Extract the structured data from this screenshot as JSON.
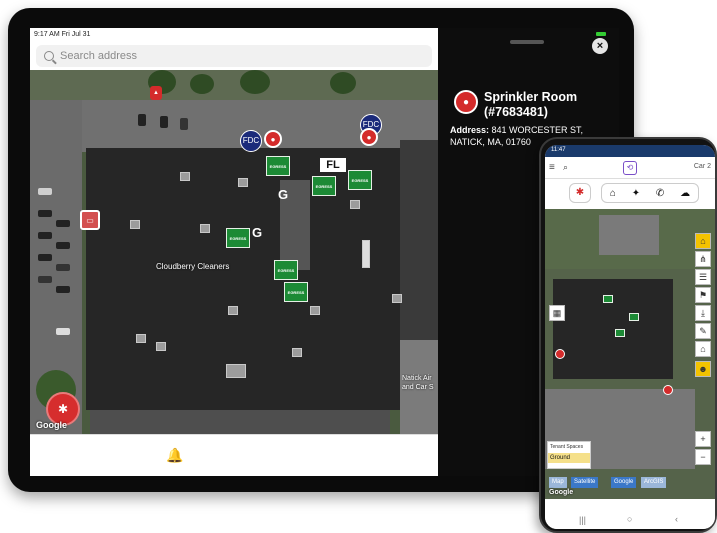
{
  "tablet": {
    "status_bar": "9:17 AM  Fri Jul 31",
    "search_placeholder": "Search address",
    "map": {
      "labels": {
        "cloudberry": "Cloudberry Cleaners",
        "natick": "Natick Air and Car S",
        "google": "Google"
      },
      "fdc_label": "FDC",
      "egress_label": "EGRESS",
      "g_label": "G",
      "fl_label": "FL"
    },
    "bottom_bar": {
      "bell_icon": "bell-icon"
    },
    "panel": {
      "title": "Sprinkler Room (#7683481)",
      "address_label": "Address:",
      "address_value": "841 WORCESTER ST, NATICK, MA, 01760",
      "close_label": "×"
    }
  },
  "phone": {
    "status_time": "11:47",
    "status_right": "Car 2",
    "map_tabs": [
      "Map",
      "Satellite"
    ],
    "provider_tabs": [
      "Google",
      "ArcGIS"
    ],
    "floor_panel": {
      "title": "Tenant Spaces",
      "selected": "Ground"
    },
    "google_label": "Google",
    "nav": [
      "|||",
      "○",
      "‹"
    ],
    "zoom_in": "+",
    "zoom_out": "−"
  },
  "colors": {
    "accent_red": "#d42b2b",
    "egress_green": "#1c8a35",
    "fdc_blue": "#1b2a7a",
    "phone_status_blue": "#1a3a6b"
  }
}
